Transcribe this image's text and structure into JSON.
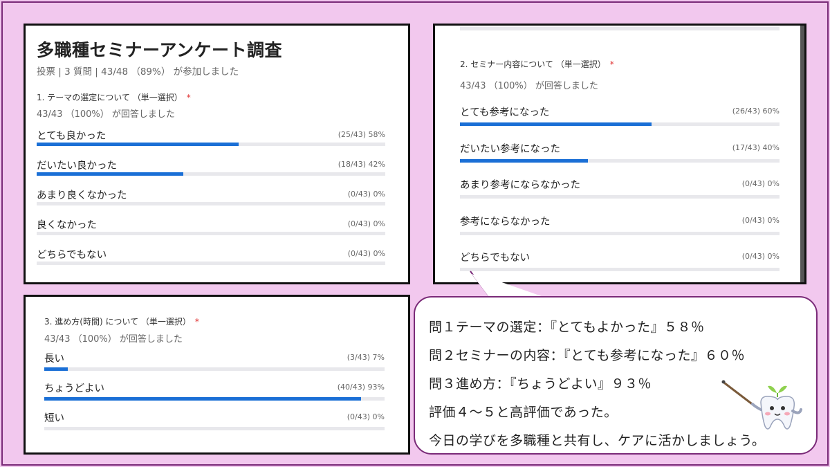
{
  "survey": {
    "title": "多職種セミナーアンケート調査",
    "meta": "投票 | 3 質問 | 43/48 （89%） が参加しました"
  },
  "questions": [
    {
      "heading": "1. テーマの選定について （単一選択）",
      "required_mark": "*",
      "responses": "43/43 （100%） が回答しました",
      "options": [
        {
          "label": "とても良かった",
          "value": "(25/43) 58%",
          "percent": 58
        },
        {
          "label": "だいたい良かった",
          "value": "(18/43) 42%",
          "percent": 42
        },
        {
          "label": "あまり良くなかった",
          "value": "(0/43) 0%",
          "percent": 0
        },
        {
          "label": "良くなかった",
          "value": "(0/43) 0%",
          "percent": 0
        },
        {
          "label": "どちらでもない",
          "value": "(0/43) 0%",
          "percent": 0
        }
      ]
    },
    {
      "heading": "2. セミナー内容について （単一選択）",
      "required_mark": "*",
      "responses": "43/43 （100%） が回答しました",
      "options": [
        {
          "label": "とても参考になった",
          "value": "(26/43) 60%",
          "percent": 60
        },
        {
          "label": "だいたい参考になった",
          "value": "(17/43) 40%",
          "percent": 40
        },
        {
          "label": "あまり参考にならなかった",
          "value": "(0/43) 0%",
          "percent": 0
        },
        {
          "label": "参考にならなかった",
          "value": "(0/43) 0%",
          "percent": 0
        },
        {
          "label": "どちらでもない",
          "value": "(0/43) 0%",
          "percent": 0
        }
      ]
    },
    {
      "heading": "3. 進め方(時間) について （単一選択）",
      "required_mark": "*",
      "responses": "43/43 （100%） が回答しました",
      "options": [
        {
          "label": "長い",
          "value": "(3/43) 7%",
          "percent": 7
        },
        {
          "label": "ちょうどよい",
          "value": "(40/43) 93%",
          "percent": 93
        },
        {
          "label": "短い",
          "value": "(0/43) 0%",
          "percent": 0
        }
      ]
    }
  ],
  "summary": {
    "lines": [
      "問１テーマの選定：『とてもよかった』５８％",
      "問２セミナーの内容：『とても参考になった』６０％",
      "問３進め方：『ちょうどよい』９３％",
      "評価４～５と高評価であった。",
      "今日の学びを多職種と共有し、ケアに活かしましょう。"
    ]
  },
  "colors": {
    "background": "#f2c8ee",
    "accent": "#1a6fd6",
    "border": "#7a2a78",
    "required": "#e03030"
  },
  "icons": {
    "mascot": "tooth-teacher-mascot",
    "pointer": "pointer-stick"
  }
}
